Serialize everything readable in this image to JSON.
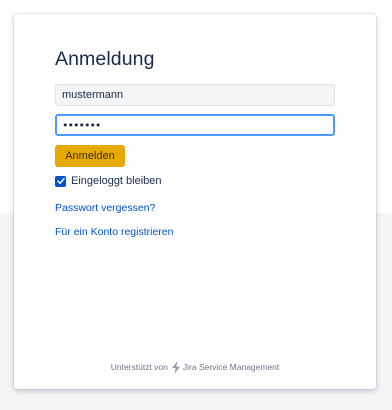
{
  "login": {
    "title": "Anmeldung",
    "username_value": "mustermann",
    "password_value": "•••••••",
    "submit_label": "Anmelden",
    "remember_label": "Eingeloggt bleiben",
    "remember_checked": true,
    "forgot_password_link": "Passwort vergessen?",
    "register_link": "Für ein Konto registrieren"
  },
  "footer": {
    "powered_by": "Unterstützt von",
    "product_name": "Jira Service Management"
  },
  "colors": {
    "accent": "#0052cc",
    "button": "#e5a900",
    "focus_border": "#4c9aff",
    "page_background_lower": "#f4f5f7"
  },
  "icons": {
    "checkbox": "checkmark-icon",
    "footer_logo": "jira-service-management-icon"
  }
}
